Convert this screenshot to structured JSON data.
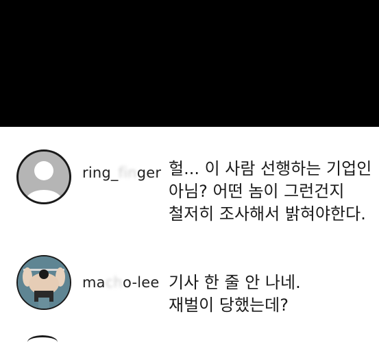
{
  "comments": [
    {
      "username_prefix": "ring_",
      "username_hidden": "fin",
      "username_suffix": "ger",
      "avatar_icon": "default-profile-icon",
      "lines": [
        "헐... 이 사람 선행하는 기업인",
        "아님? 어떤 놈이 그런건지",
        "철저히 조사해서 밝혀야한다."
      ]
    },
    {
      "username_prefix": "ma",
      "username_hidden": "ch",
      "username_suffix": "o-lee",
      "avatar_icon": "muscle-man-avatar",
      "lines": [
        "기사 한 줄 안 나네.",
        "재벌이 당했는데?"
      ]
    }
  ],
  "colors": {
    "top_band": "#000000",
    "background": "#ffffff",
    "default_avatar": "#b5b5b5",
    "photo_avatar_bg": "#5a7d8a"
  }
}
